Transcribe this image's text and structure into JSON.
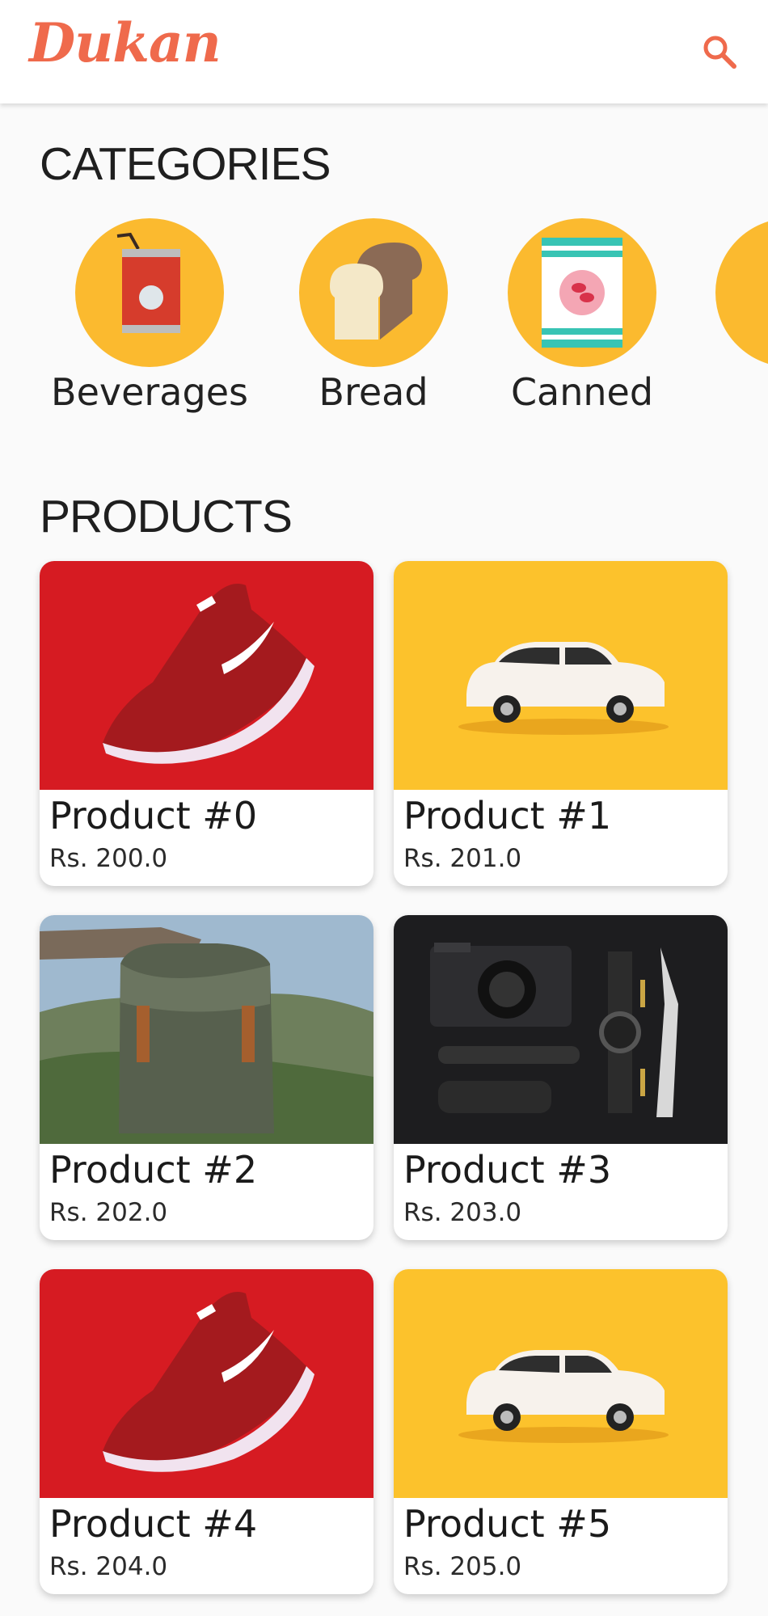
{
  "app": {
    "title": "Dukan",
    "brand_color": "#ef6a4c"
  },
  "header": {
    "search_icon": "search-icon"
  },
  "categories": {
    "title": "CATEGORIES",
    "items": [
      {
        "label": "Beverages",
        "icon": "soda-can-icon"
      },
      {
        "label": "Bread",
        "icon": "bread-icon"
      },
      {
        "label": "Canned",
        "icon": "canned-food-icon"
      }
    ]
  },
  "products": {
    "title": "PRODUCTS",
    "items": [
      {
        "name": "Product #0",
        "price": "Rs. 200.0",
        "image": "red-sneaker-photo"
      },
      {
        "name": "Product #1",
        "price": "Rs. 201.0",
        "image": "toy-car-photo"
      },
      {
        "name": "Product #2",
        "price": "Rs. 202.0",
        "image": "backpack-photo"
      },
      {
        "name": "Product #3",
        "price": "Rs. 203.0",
        "image": "camera-flatlay-photo"
      },
      {
        "name": "Product #4",
        "price": "Rs. 204.0",
        "image": "red-sneaker-photo"
      },
      {
        "name": "Product #5",
        "price": "Rs. 205.0",
        "image": "toy-car-photo"
      }
    ]
  }
}
